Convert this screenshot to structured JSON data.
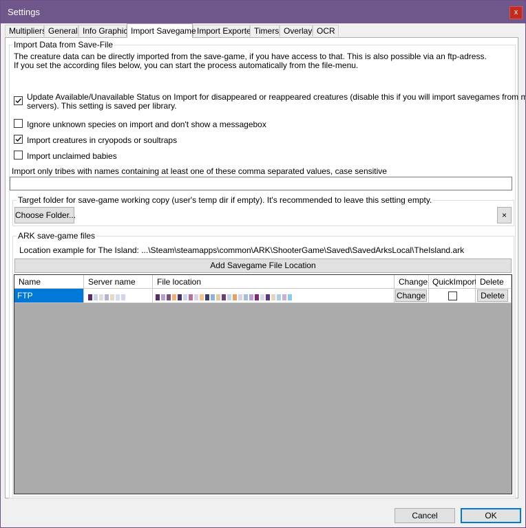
{
  "window": {
    "title": "Settings",
    "close_label": "x"
  },
  "tabs": [
    {
      "label": "Multipliers"
    },
    {
      "label": "General"
    },
    {
      "label": "Info Graphic"
    },
    {
      "label": "Import Savegame",
      "active": true
    },
    {
      "label": "Import Exported"
    },
    {
      "label": "Timers"
    },
    {
      "label": "Overlay"
    },
    {
      "label": "OCR"
    }
  ],
  "import_group": {
    "title": "Import Data from Save-File",
    "description_line1": "The creature data can be directly imported from the save-game, if you have access to that. This is also possible via an ftp-adress.",
    "description_line2": "If you set the according files below, you can start the process automatically from the file-menu."
  },
  "options": {
    "update_status": {
      "label_line1": "Update Available/Unavailable Status on Import for disappeared or reappeared creatures (disable this if you will import savegames from multiple",
      "label_line2": "servers). This setting is saved per library.",
      "checked": true
    },
    "ignore_unknown": {
      "label": "Ignore unknown species on import and don't show a messagebox",
      "checked": false
    },
    "import_cryopods": {
      "label": "Import creatures in cryopods or soultraps",
      "checked": true
    },
    "import_babies": {
      "label": "Import unclaimed babies",
      "checked": false
    }
  },
  "tribe_filter": {
    "label": "Import only tribes with names containing at least one of these comma separated values, case sensitive",
    "value": ""
  },
  "target_folder": {
    "title": "Target folder for save-game working copy (user's temp dir if empty). It's recommended to leave this setting empty.",
    "choose_label": "Choose Folder...",
    "clear_label": "×"
  },
  "savegame_files": {
    "title": "ARK save-game files",
    "example": "Location example for The Island:  ...\\Steam\\steamapps\\common\\ARK\\ShooterGame\\Saved\\SavedArksLocal\\TheIsland.ark",
    "add_label": "Add Savegame File Location",
    "columns": [
      "Name",
      "Server name",
      "File location",
      "Change",
      "QuickImport",
      "Delete"
    ],
    "rows": [
      {
        "name": "FTP",
        "change_label": "Change",
        "quick_import": false,
        "delete_label": "Delete"
      }
    ]
  },
  "footer": {
    "cancel_label": "Cancel",
    "ok_label": "OK"
  },
  "colors": {
    "titlebar": "#70578b",
    "selection": "#0078d7",
    "close": "#c42b1c"
  }
}
